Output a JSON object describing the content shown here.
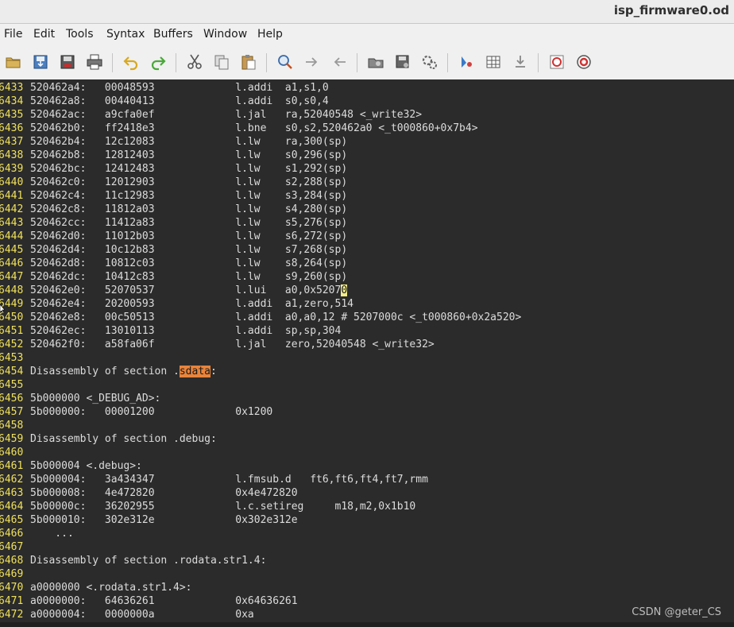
{
  "window": {
    "title": "isp_firmware0.od"
  },
  "menu": [
    "File",
    "Edit",
    "Tools",
    "Syntax",
    "Buffers",
    "Window",
    "Help"
  ],
  "toolbar": [
    {
      "name": "open-file-icon"
    },
    {
      "name": "save-file-icon"
    },
    {
      "name": "save-all-icon"
    },
    {
      "name": "print-icon"
    },
    {
      "name": "undo-icon"
    },
    {
      "name": "redo-icon"
    },
    {
      "name": "cut-icon"
    },
    {
      "name": "copy-icon"
    },
    {
      "name": "paste-icon"
    },
    {
      "name": "find-replace-icon"
    },
    {
      "name": "find-next-icon"
    },
    {
      "name": "find-prev-icon"
    },
    {
      "name": "load-session-icon"
    },
    {
      "name": "save-session-icon"
    },
    {
      "name": "run-script-icon"
    },
    {
      "name": "make-icon"
    },
    {
      "name": "build-tags-icon"
    },
    {
      "name": "jump-tag-icon"
    },
    {
      "name": "help-icon"
    },
    {
      "name": "find-help-icon"
    }
  ],
  "lines": [
    {
      "num": "6433",
      "text": "520462a4:   00048593             l.addi  a1,s1,0"
    },
    {
      "num": "6434",
      "text": "520462a8:   00440413             l.addi  s0,s0,4"
    },
    {
      "num": "6435",
      "text": "520462ac:   a9cfa0ef             l.jal   ra,52040548 <_write32>"
    },
    {
      "num": "6436",
      "text": "520462b0:   ff2418e3             l.bne   s0,s2,520462a0 <_t000860+0x7b4>"
    },
    {
      "num": "6437",
      "text": "520462b4:   12c12083             l.lw    ra,300(sp)"
    },
    {
      "num": "6438",
      "text": "520462b8:   12812403             l.lw    s0,296(sp)"
    },
    {
      "num": "6439",
      "text": "520462bc:   12412483             l.lw    s1,292(sp)"
    },
    {
      "num": "6440",
      "text": "520462c0:   12012903             l.lw    s2,288(sp)"
    },
    {
      "num": "6441",
      "text": "520462c4:   11c12983             l.lw    s3,284(sp)"
    },
    {
      "num": "6442",
      "text": "520462c8:   11812a03             l.lw    s4,280(sp)"
    },
    {
      "num": "6443",
      "text": "520462cc:   11412a83             l.lw    s5,276(sp)"
    },
    {
      "num": "6444",
      "text": "520462d0:   11012b03             l.lw    s6,272(sp)"
    },
    {
      "num": "6445",
      "text": "520462d4:   10c12b83             l.lw    s7,268(sp)"
    },
    {
      "num": "6446",
      "text": "520462d8:   10812c03             l.lw    s8,264(sp)"
    },
    {
      "num": "6447",
      "text": "520462dc:   10412c83             l.lw    s9,260(sp)"
    },
    {
      "num": "6448",
      "pre": "520462e0:   52070537             l.lui   a0,0x5207",
      "cursor": "0",
      "post": ""
    },
    {
      "num": "6449",
      "text": "520462e4:   20200593             l.addi  a1,zero,514"
    },
    {
      "num": "6450",
      "text": "520462e8:   00c50513             l.addi  a0,a0,12 # 5207000c <_t000860+0x2a520>"
    },
    {
      "num": "6451",
      "text": "520462ec:   13010113             l.addi  sp,sp,304"
    },
    {
      "num": "6452",
      "text": "520462f0:   a58fa06f             l.jal   zero,52040548 <_write32>"
    },
    {
      "num": "6453",
      "text": ""
    },
    {
      "num": "6454",
      "pre": "Disassembly of section .",
      "hl": "sdata",
      "post": ":"
    },
    {
      "num": "6455",
      "text": ""
    },
    {
      "num": "6456",
      "text": "5b000000 <_DEBUG_AD>:"
    },
    {
      "num": "6457",
      "text": "5b000000:   00001200             0x1200"
    },
    {
      "num": "6458",
      "text": ""
    },
    {
      "num": "6459",
      "text": "Disassembly of section .debug:"
    },
    {
      "num": "6460",
      "text": ""
    },
    {
      "num": "6461",
      "text": "5b000004 <.debug>:"
    },
    {
      "num": "6462",
      "text": "5b000004:   3a434347             l.fmsub.d   ft6,ft6,ft4,ft7,rmm"
    },
    {
      "num": "6463",
      "text": "5b000008:   4e472820             0x4e472820"
    },
    {
      "num": "6464",
      "text": "5b00000c:   36202955             l.c.setireg     m18,m2,0x1b10"
    },
    {
      "num": "6465",
      "text": "5b000010:   302e312e             0x302e312e"
    },
    {
      "num": "6466",
      "text": "    ..."
    },
    {
      "num": "6467",
      "text": ""
    },
    {
      "num": "6468",
      "text": "Disassembly of section .rodata.str1.4:"
    },
    {
      "num": "6469",
      "text": ""
    },
    {
      "num": "6470",
      "text": "a0000000 <.rodata.str1.4>:"
    },
    {
      "num": "6471",
      "text": "a0000000:   64636261             0x64636261"
    },
    {
      "num": "6472",
      "text": "a0000004:   0000000a             0xa"
    }
  ],
  "watermark": "CSDN @geter_CS",
  "colors": {
    "line_number": "#f0e15a",
    "search_highlight": "#e8843c",
    "cursor": "#f2ec8a",
    "background": "#2b2b2b",
    "text": "#dcdcdc"
  }
}
